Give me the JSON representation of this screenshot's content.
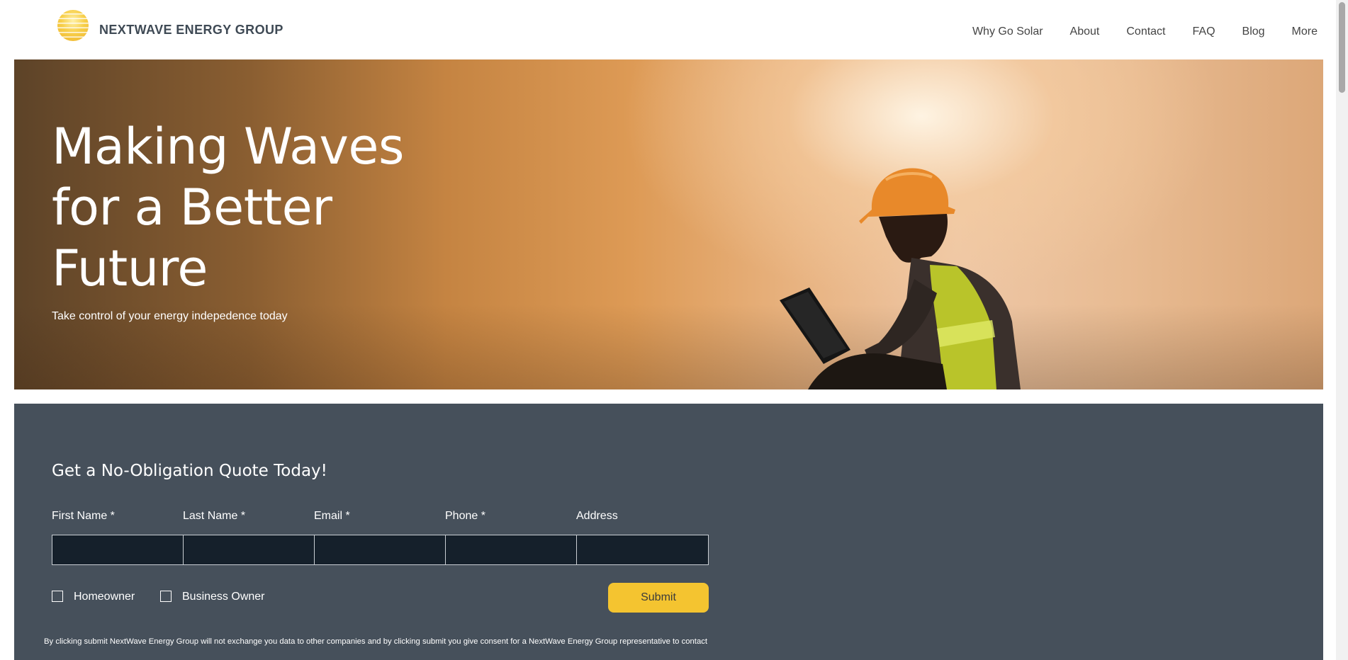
{
  "header": {
    "brand": "NEXTWAVE ENERGY GROUP",
    "nav": [
      "Why Go Solar",
      "About",
      "Contact",
      "FAQ",
      "Blog",
      "More"
    ]
  },
  "hero": {
    "title_lines": [
      "Making Waves",
      "for a Better",
      "Future"
    ],
    "subtitle": "Take control of your energy indepedence today"
  },
  "quote_form": {
    "title": "Get a No-Obligation Quote Today!",
    "fields": [
      {
        "label": "First Name *",
        "value": ""
      },
      {
        "label": "Last Name *",
        "value": ""
      },
      {
        "label": "Email *",
        "value": ""
      },
      {
        "label": "Phone *",
        "value": ""
      },
      {
        "label": "Address",
        "value": ""
      }
    ],
    "checkboxes": [
      {
        "label": "Homeowner",
        "checked": false
      },
      {
        "label": "Business Owner",
        "checked": false
      }
    ],
    "submit_label": "Submit",
    "disclaimer": "By clicking submit NextWave Energy Group will not exchange you data to other companies and by clicking submit you give consent for a NextWave Energy Group  representative to contact"
  },
  "colors": {
    "brand_text": "#3f4a55",
    "section_bg": "#46505b",
    "input_bg": "#15202b",
    "submit_bg": "#f4c430"
  }
}
